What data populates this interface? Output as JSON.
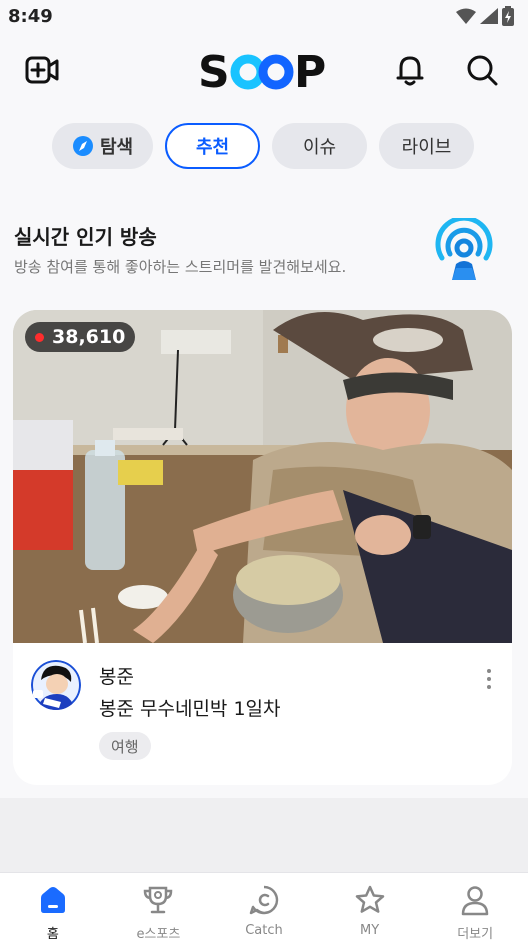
{
  "status": {
    "time": "8:49"
  },
  "header": {
    "logo_text": "SOOP"
  },
  "tabs": [
    {
      "label": "탐색"
    },
    {
      "label": "추천"
    },
    {
      "label": "이슈"
    },
    {
      "label": "라이브"
    }
  ],
  "section": {
    "title": "실시간 인기 방송",
    "subtitle": "방송 참여를 통해 좋아하는 스트리머를 발견해보세요."
  },
  "card": {
    "viewers": "38,610",
    "streamer": "봉준",
    "title": "봉준 무수네민박 1일차",
    "tag": "여행"
  },
  "bottom_nav": [
    {
      "label": "홈",
      "icon": "home-icon"
    },
    {
      "label": "e스포츠",
      "icon": "trophy-icon"
    },
    {
      "label": "Catch",
      "icon": "catch-icon"
    },
    {
      "label": "MY",
      "icon": "star-icon"
    },
    {
      "label": "더보기",
      "icon": "person-icon"
    }
  ],
  "colors": {
    "accent": "#0a5cff",
    "live": "#ff2d2d"
  }
}
